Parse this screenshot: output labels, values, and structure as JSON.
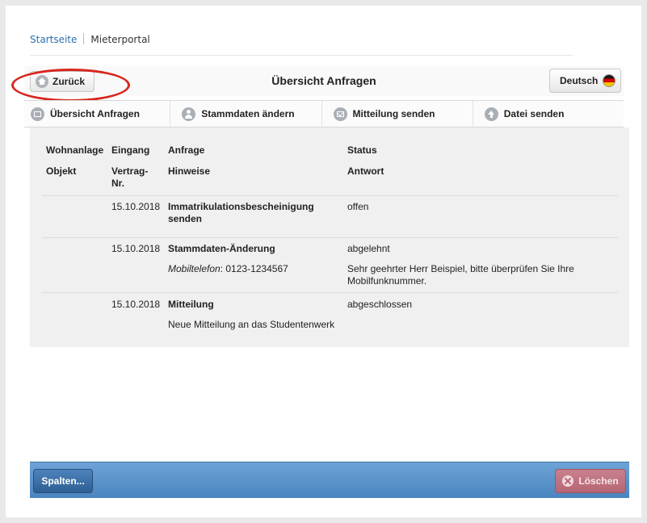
{
  "breadcrumb": {
    "home": "Startseite",
    "current": "Mieterportal"
  },
  "header": {
    "back_label": "Zurück",
    "title": "Übersicht Anfragen",
    "language_label": "Deutsch"
  },
  "tabs": [
    {
      "label": "Übersicht Anfragen",
      "icon": "calendar-icon"
    },
    {
      "label": "Stammdaten ändern",
      "icon": "user-icon"
    },
    {
      "label": "Mitteilung senden",
      "icon": "mail-icon"
    },
    {
      "label": "Datei senden",
      "icon": "upload-icon"
    }
  ],
  "table": {
    "header_row1": [
      "Wohnanlage",
      "Eingang",
      "Anfrage",
      "Status"
    ],
    "header_row2": [
      "Objekt",
      "Vertrag-\nNr.",
      "Hinweise",
      "Antwort"
    ],
    "rows": [
      {
        "date": "15.10.2018",
        "request": "Immatrikulationsbescheinigung senden",
        "status": "offen",
        "note_label": "",
        "note_value": "",
        "answer": ""
      },
      {
        "date": "15.10.2018",
        "request": "Stammdaten-Änderung",
        "status": "abgelehnt",
        "note_label": "Mobiltelefon",
        "note_value": ": 0123-1234567",
        "answer": "Sehr geehrter Herr Beispiel, bitte überprüfen Sie Ihre Mobilfunknummer."
      },
      {
        "date": "15.10.2018",
        "request": "Mitteilung",
        "status": "abgeschlossen",
        "note_label": "",
        "note_value": "Neue Mitteilung an das Studentenwerk",
        "answer": ""
      }
    ]
  },
  "footer": {
    "columns_label": "Spalten...",
    "delete_label": "Löschen"
  },
  "colors": {
    "annotation_circle": "#d8261e",
    "footer_blue": "#5a94cb",
    "delete_button": "#bf7280"
  }
}
